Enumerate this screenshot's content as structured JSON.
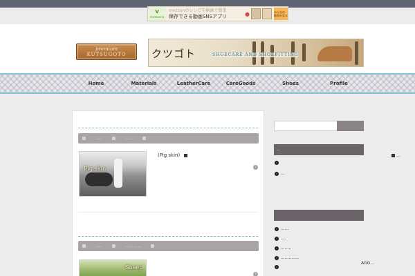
{
  "ad": {
    "brand": "v",
    "brand_sub": "mezzonna",
    "line1": "mezzanのレシピを動画で簡単",
    "line2": "保存できる動画SNSアプリ",
    "cta": "みんなの 動画を見る"
  },
  "logo": {
    "line1": "premium",
    "line2": "KUTSUGOTO"
  },
  "hero": {
    "title": "クツゴト",
    "subtitle": "SHOECARE AND SHOEFITTING"
  },
  "nav": [
    {
      "label": "Home"
    },
    {
      "label": "Materials"
    },
    {
      "label": "LeatherCare"
    },
    {
      "label": "CareGoods"
    },
    {
      "label": "Shoes"
    },
    {
      "label": "Profile"
    }
  ],
  "posts": [
    {
      "title": "(Pig skin)",
      "thumb_label": "Pig skin",
      "meta": [
        "......",
        "... ...",
        ""
      ]
    },
    {
      "title": "",
      "thumb_label": "Sheep",
      "meta": [
        "......",
        "... ... ... ...",
        ""
      ]
    }
  ],
  "sidebar": {
    "widget1_title": "...",
    "widget1_items": [
      "",
      "..."
    ],
    "widget2_title": "",
    "widget2_items": [
      "......",
      "....",
      "........",
      "..............",
      ""
    ],
    "far_right": "...",
    "agg": "AGG..."
  }
}
